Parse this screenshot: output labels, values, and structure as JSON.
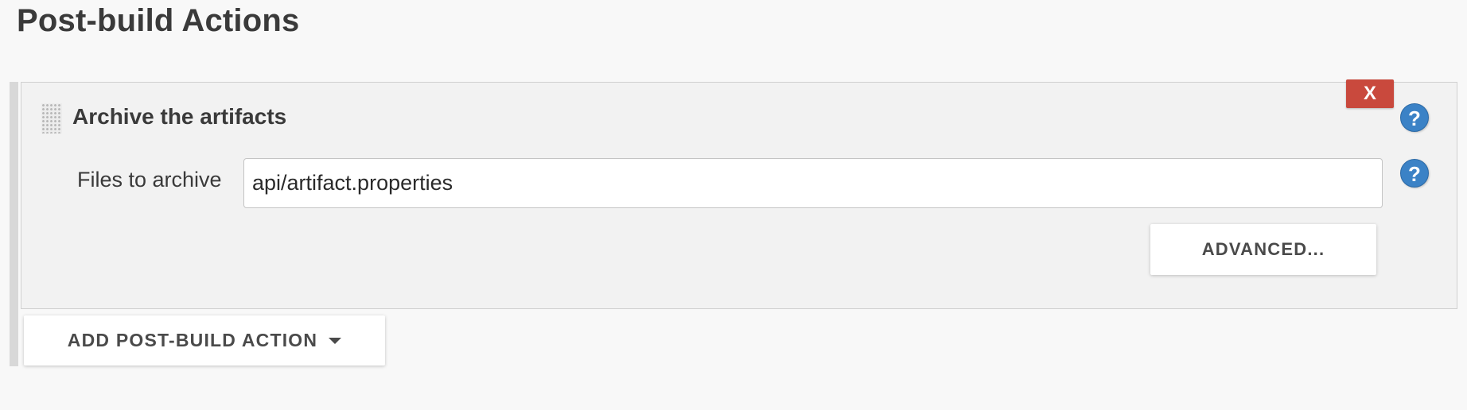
{
  "section": {
    "title": "Post-build Actions"
  },
  "archive_step": {
    "title": "Archive the artifacts",
    "delete_label": "X",
    "help_label": "?",
    "files_label": "Files to archive",
    "files_value": "api/artifact.properties",
    "advanced_label": "ADVANCED..."
  },
  "add_action": {
    "label": "ADD POST-BUILD ACTION",
    "caret_icon": "caret-down-icon"
  },
  "colors": {
    "delete_button": "#c9493d",
    "help_button": "#3b82c6",
    "panel_background": "#f2f2f2",
    "page_background": "#f8f8f8"
  }
}
